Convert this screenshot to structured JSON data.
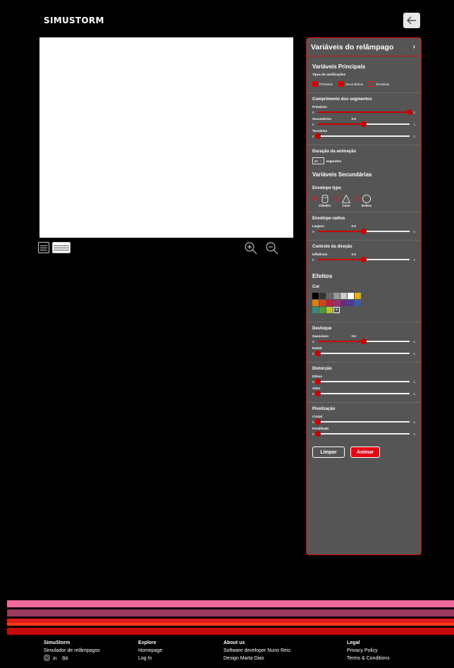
{
  "header": {
    "logo": "SIMUSTORM",
    "back_icon": "arrow-left-icon"
  },
  "canvas": {
    "view_modes": [
      "list-view-icon",
      "wide-view-icon"
    ],
    "zoom": [
      "zoom-in-icon",
      "zoom-out-icon"
    ]
  },
  "panel": {
    "title": "Variáveis do relâmpago",
    "main": {
      "title": "Variáveis Principais",
      "branch_types_label": "Tipos de ramificações",
      "branch_types": [
        {
          "label": "Primárias",
          "checked": true
        },
        {
          "label": "Secundárias",
          "checked": true
        },
        {
          "label": "Terciárias",
          "checked": false
        }
      ]
    },
    "segments": {
      "title": "Comprimento dos segmentos",
      "sliders": [
        {
          "label": "Primários",
          "value": 1,
          "display": "",
          "min": "0",
          "max": "1"
        },
        {
          "label": "Secundários",
          "value": 0.5,
          "display": "0.5",
          "min": "0",
          "max": "1"
        },
        {
          "label": "Terciários",
          "value": 0,
          "display": "",
          "min": "0",
          "max": "1"
        }
      ]
    },
    "duration": {
      "title": "Duração da animação",
      "value": "30",
      "unit": "segundos"
    },
    "secondary": {
      "title": "Variáveis Secundárias",
      "envelope_label": "Envelope type",
      "envelopes": [
        {
          "label": "Cilindro",
          "selected": true
        },
        {
          "label": "Cone",
          "selected": false
        },
        {
          "label": "Esfera",
          "selected": false
        }
      ]
    },
    "radius": {
      "title": "Envelope radius",
      "sliders": [
        {
          "label": "Largura",
          "value": 0.5,
          "display": "0.5",
          "min": "0",
          "max": "1"
        }
      ]
    },
    "direction": {
      "title": "Controlo da direção",
      "sliders": [
        {
          "label": "Influência",
          "value": 0.5,
          "display": "0.5",
          "min": "0",
          "max": "1"
        }
      ]
    },
    "effects": {
      "title": "Efeitos",
      "color_label": "Cor",
      "swatches": [
        "#000000",
        "#333333",
        "#666666",
        "#999999",
        "#cccccc",
        "#ffffff",
        "#e3b10a",
        "#e07d0f",
        "#d2421a",
        "#c01f3c",
        "#a02a6a",
        "#6a2a7a",
        "#4a3a9a",
        "#3a5aa8",
        "#3a8a7a",
        "#4a9a3a",
        "#b8c42a"
      ],
      "add_symbol": "+"
    },
    "blur": {
      "title": "Desfoque",
      "sliders": [
        {
          "label": "Gaussiano",
          "value": 0.5,
          "display": "0.5",
          "min": "0",
          "max": "1"
        },
        {
          "label": "Radial",
          "value": 0,
          "display": "",
          "min": "0",
          "max": "1"
        }
      ]
    },
    "distortion": {
      "title": "Distorção",
      "sliders": [
        {
          "label": "Difuso",
          "value": 0,
          "display": "",
          "min": "0",
          "max": "1"
        },
        {
          "label": "Vidro",
          "value": 0,
          "display": "",
          "min": "0",
          "max": "1"
        }
      ]
    },
    "pixel": {
      "title": "Pixelização",
      "sliders": [
        {
          "label": "Cristal",
          "value": 0,
          "display": "",
          "min": "0",
          "max": "1"
        },
        {
          "label": "Pontilhado",
          "value": 0,
          "display": "",
          "min": "0",
          "max": "1"
        }
      ]
    },
    "buttons": {
      "clear": "Limpar",
      "animate": "Animar"
    }
  },
  "stripes": [
    "#f06a9b",
    "#9a3a5e",
    "#e11c1c",
    "#ff3a1a",
    "#c40a0a"
  ],
  "footer": {
    "col1": {
      "title": "SimuStorm",
      "line1": "Simulador de relâmpagos",
      "icons": [
        "instagram-icon",
        "linkedin-icon",
        "behance-icon"
      ]
    },
    "col2": {
      "title": "Explore",
      "line1": "Homepage",
      "line2": "Log In"
    },
    "col3": {
      "title": "About us",
      "line1": "Software developer Nuno Reis",
      "line2": "Design Marta Dias"
    },
    "col4": {
      "title": "Legal",
      "line1": "Privacy Policy",
      "line2": "Terms & Conditions"
    }
  }
}
